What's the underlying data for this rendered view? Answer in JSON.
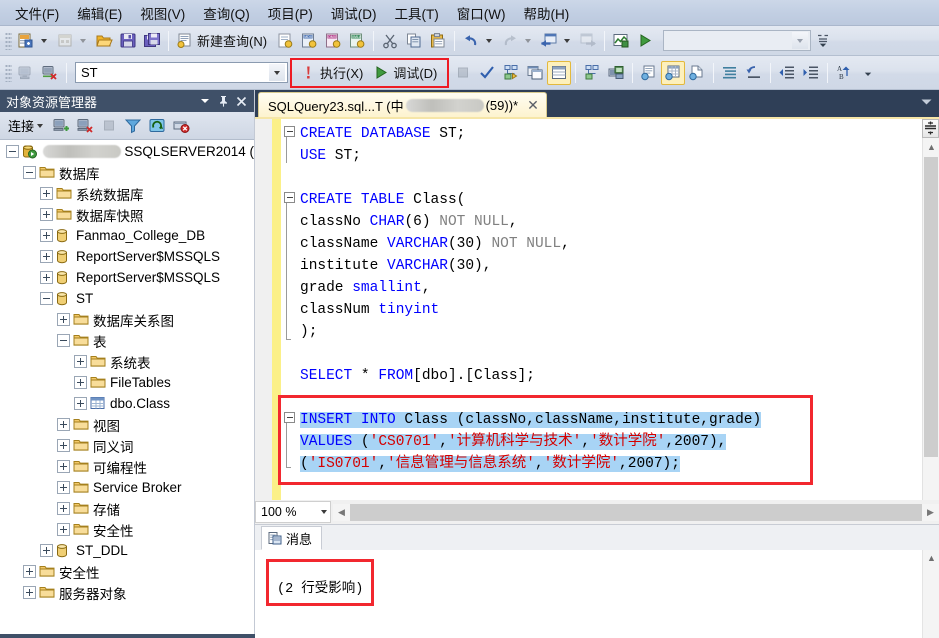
{
  "menu": {
    "items": [
      {
        "label": "文件(F)",
        "name": "menu-file"
      },
      {
        "label": "编辑(E)",
        "name": "menu-edit"
      },
      {
        "label": "视图(V)",
        "name": "menu-view"
      },
      {
        "label": "查询(Q)",
        "name": "menu-query"
      },
      {
        "label": "项目(P)",
        "name": "menu-project"
      },
      {
        "label": "调试(D)",
        "name": "menu-debug"
      },
      {
        "label": "工具(T)",
        "name": "menu-tools"
      },
      {
        "label": "窗口(W)",
        "name": "menu-window"
      },
      {
        "label": "帮助(H)",
        "name": "menu-help"
      }
    ]
  },
  "toolbar": {
    "new_query_label": "新建查询(N)",
    "execute_label": "执行(X)",
    "debug_label": "调试(D)",
    "database_value": "ST",
    "generic_combo_value": ""
  },
  "object_explorer": {
    "title": "对象资源管理器",
    "connect_label": "连接",
    "tree": [
      {
        "label": "SSQLSERVER2014 (",
        "name": "tree-server",
        "indent": 0,
        "expander": "minus",
        "icon": "server-icon",
        "redacted": true
      },
      {
        "label": "数据库",
        "name": "tree-databases",
        "indent": 1,
        "expander": "minus",
        "icon": "folder-icon"
      },
      {
        "label": "系统数据库",
        "name": "tree-system-databases",
        "indent": 2,
        "expander": "plus",
        "icon": "folder-icon"
      },
      {
        "label": "数据库快照",
        "name": "tree-database-snapshots",
        "indent": 2,
        "expander": "plus",
        "icon": "folder-icon"
      },
      {
        "label": "Fanmao_College_DB",
        "name": "tree-db-fanmao-college",
        "indent": 2,
        "expander": "plus",
        "icon": "database-icon"
      },
      {
        "label": "ReportServer$MSSQLS",
        "name": "tree-db-reportserver",
        "indent": 2,
        "expander": "plus",
        "icon": "database-icon"
      },
      {
        "label": "ReportServer$MSSQLS",
        "name": "tree-db-reportserver-tempdb",
        "indent": 2,
        "expander": "plus",
        "icon": "database-icon"
      },
      {
        "label": "ST",
        "name": "tree-db-st",
        "indent": 2,
        "expander": "minus",
        "icon": "database-icon"
      },
      {
        "label": "数据库关系图",
        "name": "tree-database-diagrams",
        "indent": 3,
        "expander": "plus",
        "icon": "folder-icon"
      },
      {
        "label": "表",
        "name": "tree-tables",
        "indent": 3,
        "expander": "minus",
        "icon": "folder-icon"
      },
      {
        "label": "系统表",
        "name": "tree-system-tables",
        "indent": 4,
        "expander": "plus",
        "icon": "folder-icon"
      },
      {
        "label": "FileTables",
        "name": "tree-filetables",
        "indent": 4,
        "expander": "plus",
        "icon": "folder-icon"
      },
      {
        "label": "dbo.Class",
        "name": "tree-table-dbo-class",
        "indent": 4,
        "expander": "plus",
        "icon": "table-icon"
      },
      {
        "label": "视图",
        "name": "tree-views",
        "indent": 3,
        "expander": "plus",
        "icon": "folder-icon"
      },
      {
        "label": "同义词",
        "name": "tree-synonyms",
        "indent": 3,
        "expander": "plus",
        "icon": "folder-icon"
      },
      {
        "label": "可编程性",
        "name": "tree-programmability",
        "indent": 3,
        "expander": "plus",
        "icon": "folder-icon"
      },
      {
        "label": "Service Broker",
        "name": "tree-service-broker",
        "indent": 3,
        "expander": "plus",
        "icon": "folder-icon"
      },
      {
        "label": "存储",
        "name": "tree-storage",
        "indent": 3,
        "expander": "plus",
        "icon": "folder-icon"
      },
      {
        "label": "安全性",
        "name": "tree-db-security",
        "indent": 3,
        "expander": "plus",
        "icon": "folder-icon"
      },
      {
        "label": "ST_DDL",
        "name": "tree-db-st-ddl",
        "indent": 2,
        "expander": "plus",
        "icon": "database-icon"
      },
      {
        "label": "安全性",
        "name": "tree-server-security",
        "indent": 1,
        "expander": "plus",
        "icon": "folder-icon"
      },
      {
        "label": "服务器对象",
        "name": "tree-server-objects",
        "indent": 1,
        "expander": "plus",
        "icon": "folder-icon"
      }
    ]
  },
  "editor": {
    "tab_prefix": "SQLQuery23.sql...T (中",
    "tab_suffix": "(59))*",
    "close_label": "✕",
    "zoom_value": "100 %",
    "code_lines": [
      [
        {
          "t": "CREATE",
          "c": "kw"
        },
        {
          "t": " ",
          "c": ""
        },
        {
          "t": "DATABASE",
          "c": "kw"
        },
        {
          "t": " ST;",
          "c": ""
        }
      ],
      [
        {
          "t": "USE",
          "c": "kw"
        },
        {
          "t": " ST;",
          "c": ""
        }
      ],
      [],
      [
        {
          "t": "CREATE",
          "c": "kw"
        },
        {
          "t": " ",
          "c": ""
        },
        {
          "t": "TABLE",
          "c": "kw"
        },
        {
          "t": " Class(",
          "c": ""
        }
      ],
      [
        {
          "t": "classNo ",
          "c": ""
        },
        {
          "t": "CHAR",
          "c": "kw"
        },
        {
          "t": "(6) ",
          "c": ""
        },
        {
          "t": "NOT NULL",
          "c": "gry"
        },
        {
          "t": ",",
          "c": ""
        }
      ],
      [
        {
          "t": "className ",
          "c": ""
        },
        {
          "t": "VARCHAR",
          "c": "kw"
        },
        {
          "t": "(30) ",
          "c": ""
        },
        {
          "t": "NOT NULL",
          "c": "gry"
        },
        {
          "t": ",",
          "c": ""
        }
      ],
      [
        {
          "t": "institute ",
          "c": ""
        },
        {
          "t": "VARCHAR",
          "c": "kw"
        },
        {
          "t": "(30),",
          "c": ""
        }
      ],
      [
        {
          "t": "grade ",
          "c": ""
        },
        {
          "t": "smallint",
          "c": "kw"
        },
        {
          "t": ",",
          "c": ""
        }
      ],
      [
        {
          "t": "classNum ",
          "c": ""
        },
        {
          "t": "tinyint",
          "c": "kw"
        }
      ],
      [
        {
          "t": ");",
          "c": ""
        }
      ],
      [],
      [
        {
          "t": "SELECT",
          "c": "kw"
        },
        {
          "t": " * ",
          "c": ""
        },
        {
          "t": "FROM",
          "c": "kw"
        },
        {
          "t": "[dbo].[Class];",
          "c": ""
        }
      ],
      [],
      [
        {
          "t": "INSERT",
          "c": "kw sel"
        },
        {
          "t": " ",
          "c": "sel"
        },
        {
          "t": "INTO",
          "c": "kw sel"
        },
        {
          "t": " Class (classNo,className,institute,grade)",
          "c": "sel"
        }
      ],
      [
        {
          "t": "VALUES",
          "c": "kw sel"
        },
        {
          "t": " (",
          "c": "sel"
        },
        {
          "t": "'CS0701'",
          "c": "str sel"
        },
        {
          "t": ",",
          "c": "sel"
        },
        {
          "t": "'计算机科学与技术'",
          "c": "str sel"
        },
        {
          "t": ",",
          "c": "sel"
        },
        {
          "t": "'数计学院'",
          "c": "str sel"
        },
        {
          "t": ",2007),",
          "c": "sel"
        }
      ],
      [
        {
          "t": "(",
          "c": "sel"
        },
        {
          "t": "'IS0701'",
          "c": "str sel"
        },
        {
          "t": ",",
          "c": "sel"
        },
        {
          "t": "'信息管理与信息系统'",
          "c": "str sel"
        },
        {
          "t": ",",
          "c": "sel"
        },
        {
          "t": "'数计学院'",
          "c": "str sel"
        },
        {
          "t": ",2007);",
          "c": "sel"
        }
      ]
    ]
  },
  "results": {
    "tab_label": "消息",
    "message": "(2 行受影响)"
  },
  "colors": {
    "annotation_red": "#f2282f",
    "keyword_blue": "#0000ff",
    "string_red": "#d40000",
    "selection_blue": "#a8d4f5",
    "change_bar_yellow": "#fbf088",
    "panel_header": "#3f5068"
  }
}
